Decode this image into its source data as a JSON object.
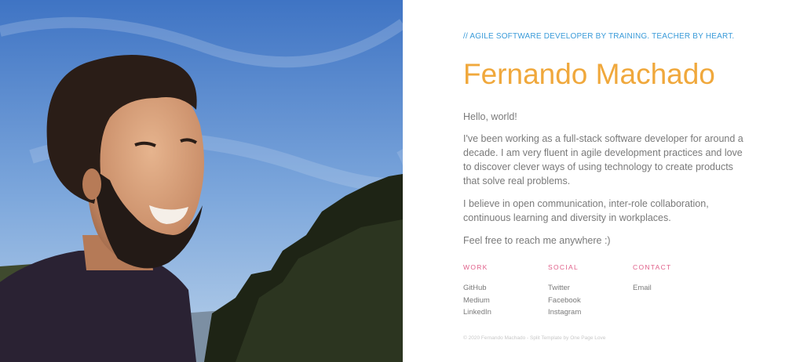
{
  "photo": {
    "alt": "Fernando Machado"
  },
  "hero": {
    "tagline": "// AGILE SOFTWARE DEVELOPER BY TRAINING. TEACHER BY HEART.",
    "name": "Fernando Machado"
  },
  "bio": {
    "greeting": "Hello, world!",
    "paragraph1": "I've been working as a full-stack software developer for around a decade. I am very fluent in agile development practices and love to discover clever ways of using technology to create products that solve real problems.",
    "paragraph2": "I believe in open communication, inter-role collaboration, continuous learning and diversity in workplaces.",
    "paragraph3": "Feel free to reach me anywhere :)"
  },
  "links": {
    "work": {
      "title": "WORK",
      "items": [
        "GitHub",
        "Medium",
        "LinkedIn"
      ]
    },
    "social": {
      "title": "SOCIAL",
      "items": [
        "Twitter",
        "Facebook",
        "Instagram"
      ]
    },
    "contact": {
      "title": "CONTACT",
      "items": [
        "Email"
      ]
    }
  },
  "footer": {
    "text": "© 2020 Fernando Machado - Split Template by One Page Love"
  },
  "colors": {
    "tagline": "#3a9bd9",
    "name": "#f0a83c",
    "column_titles": "#e0608a",
    "body_text": "#7a7a7a"
  }
}
